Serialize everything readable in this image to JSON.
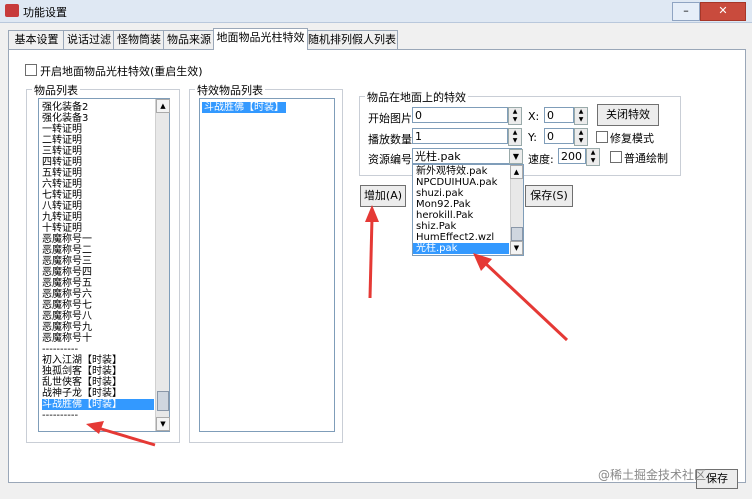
{
  "window": {
    "title": "功能设置"
  },
  "tabs": [
    "基本设置",
    "说话过滤",
    "怪物筒装",
    "物品来源",
    "地面物品光柱特效",
    "随机排列假人列表"
  ],
  "enable_checkbox": {
    "label": "开启地面物品光柱特效(重启生效)"
  },
  "item_list": {
    "title": "物品列表",
    "items": [
      "强化装备2",
      "强化装备3",
      "一转证明",
      "二转证明",
      "三转证明",
      "四转证明",
      "五转证明",
      "六转证明",
      "七转证明",
      "八转证明",
      "九转证明",
      "十转证明",
      "恶魔称号一",
      "恶魔称号二",
      "恶魔称号三",
      "恶魔称号四",
      "恶魔称号五",
      "恶魔称号六",
      "恶魔称号七",
      "恶魔称号八",
      "恶魔称号九",
      "恶魔称号十",
      "----------",
      "初入江湖【时装】",
      "独孤剑客【时装】",
      "乱世侠客【时装】",
      "战神子龙【时装】",
      "斗战胜佛【时装】",
      "----------"
    ]
  },
  "effect_list": {
    "title": "特效物品列表",
    "items": [
      "斗战胜佛【时装】"
    ]
  },
  "effect_panel": {
    "title": "物品在地面上的特效",
    "start_image": {
      "label": "开始图片:",
      "value": "0"
    },
    "x": {
      "label": "X:",
      "value": "0"
    },
    "close_effect_button": "关闭特效",
    "play_count": {
      "label": "播放数量:",
      "value": "1"
    },
    "y": {
      "label": "Y:",
      "value": "0"
    },
    "repair_mode": "修复模式",
    "resource": {
      "label": "资源编号:",
      "value": "光柱.pak"
    },
    "speed": {
      "label": "速度:",
      "value": "200"
    },
    "normal_draw": "普通绘制",
    "dropdown_options": [
      "新外观特效.pak",
      "NPCDUIHUA.pak",
      "shuzi.pak",
      "Mon92.Pak",
      "herokill.Pak",
      "shiz.Pak",
      "HumEffect2.wzl",
      "光柱.pak"
    ],
    "dropdown_selected_index": 7
  },
  "buttons": {
    "add": "增加(A)",
    "save": "保存(S)",
    "ok": "保存"
  },
  "watermark": {
    "text": "@稀土掘金技术社区"
  }
}
